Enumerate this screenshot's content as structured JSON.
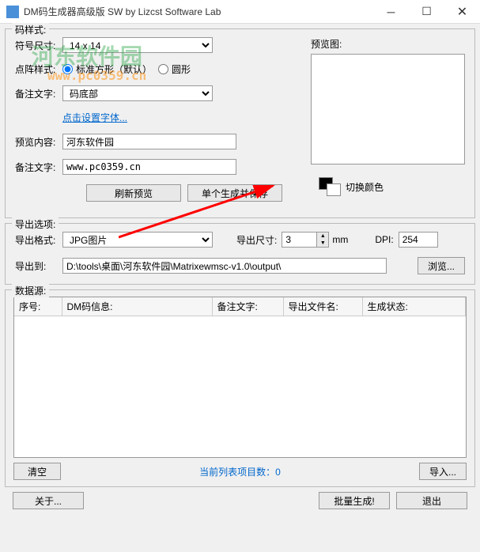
{
  "window": {
    "title": "DM码生成器高级版 SW   by Lizcst Software Lab"
  },
  "style_section": {
    "title": "码样式:",
    "symbol_size_label": "符号尺寸:",
    "symbol_size_value": "14 x 14",
    "dot_style_label": "点阵样式:",
    "radio_square": "标准方形（默认）",
    "radio_round": "圆形",
    "remark_style_label": "备注文字:",
    "remark_style_value": "码底部",
    "font_link": "点击设置字体...",
    "preview_content_label": "预览内容:",
    "preview_content_value": "河东软件园",
    "remark_text_label": "备注文字:",
    "remark_text_value": "www.pc0359.cn",
    "preview_label": "预览图:",
    "color_swap_label": "切换颜色",
    "refresh_btn": "刷新预览",
    "single_gen_btn": "单个生成并保存"
  },
  "export_section": {
    "title": "导出选项:",
    "format_label": "导出格式:",
    "format_value": "JPG图片",
    "size_label": "导出尺寸:",
    "size_value": "3",
    "size_unit": "mm",
    "dpi_label": "DPI:",
    "dpi_value": "254",
    "path_label": "导出到:",
    "path_value": "D:\\tools\\桌面\\河东软件园\\Matrixewmsc-v1.0\\output\\",
    "browse_btn": "浏览..."
  },
  "data_section": {
    "title": "数据源:",
    "col_index": "序号:",
    "col_dm": "DM码信息:",
    "col_remark": "备注文字:",
    "col_filename": "导出文件名:",
    "col_status": "生成状态:",
    "clear_btn": "清空",
    "status_text": "当前列表项目数：0",
    "import_btn": "导入..."
  },
  "bottom": {
    "about_btn": "关于...",
    "batch_btn": "批量生成!",
    "exit_btn": "退出"
  }
}
